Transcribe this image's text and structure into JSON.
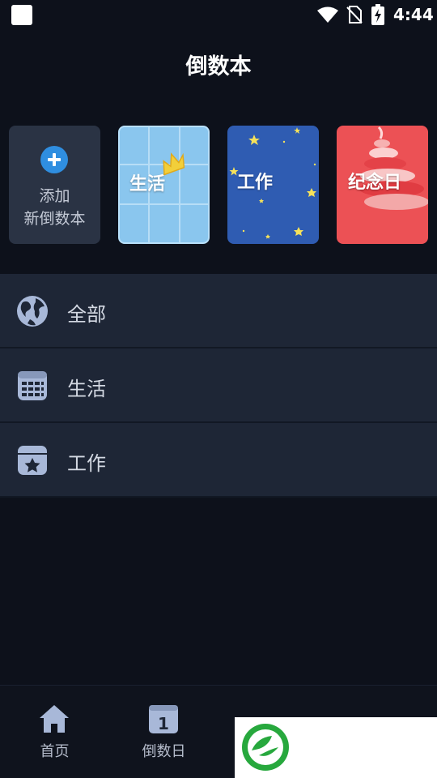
{
  "status_bar": {
    "time": "4:44"
  },
  "page": {
    "title": "倒数本"
  },
  "cards": {
    "add": {
      "line1": "添加",
      "line2": "新倒数本"
    },
    "life": {
      "label": "生活"
    },
    "work": {
      "label": "工作"
    },
    "anniversary": {
      "label": "纪念日"
    }
  },
  "categories": [
    {
      "label": "全部",
      "icon": "globe-icon"
    },
    {
      "label": "生活",
      "icon": "calendar-grid-icon"
    },
    {
      "label": "工作",
      "icon": "star-folder-icon"
    }
  ],
  "bottom_nav": [
    {
      "label": "首页",
      "icon": "home-icon"
    },
    {
      "label": "倒数日",
      "icon": "calendar-day-icon",
      "day": "1"
    }
  ],
  "colors": {
    "background": "#0d111b",
    "row": "#1e2636",
    "accent": "#2f8ee0",
    "life_card": "#8ac6ee",
    "work_card": "#2f5cb2",
    "anniversary_card": "#ec5155",
    "icon": "#a8b8d8"
  }
}
